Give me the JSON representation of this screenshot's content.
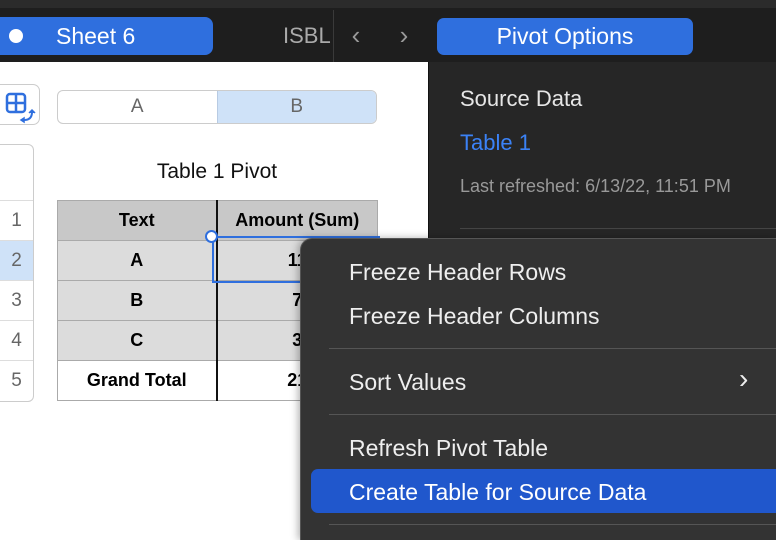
{
  "toolbar": {
    "sheet_tab": "Sheet 6",
    "next_tab_partial": "ISBL",
    "prev_icon": "chevron-left",
    "next_icon": "chevron-right"
  },
  "sheet": {
    "columns": [
      "A",
      "B"
    ],
    "row_numbers": [
      "1",
      "2",
      "3",
      "4",
      "5"
    ],
    "table_title": "Table 1 Pivot",
    "headers": [
      "Text",
      "Amount (Sum)"
    ],
    "rows": [
      {
        "label": "A",
        "value": "11"
      },
      {
        "label": "B",
        "value": "7"
      },
      {
        "label": "C",
        "value": "3"
      }
    ],
    "total": {
      "label": "Grand Total",
      "value": "21"
    }
  },
  "panel": {
    "button": "Pivot Options",
    "source_label": "Source Data",
    "source_table": "Table 1",
    "last_refreshed": "Last refreshed: 6/13/22, 11:51 PM"
  },
  "menu": {
    "items": [
      "Freeze Header Rows",
      "Freeze Header Columns",
      "Sort Values",
      "Refresh Pivot Table",
      "Create Table for Source Data"
    ],
    "submenu_arrow": "›",
    "highlighted": "Create Table for Source Data"
  },
  "colors": {
    "accent": "#2f6fde",
    "highlight": "#2057cc",
    "link": "#3b82f6"
  }
}
